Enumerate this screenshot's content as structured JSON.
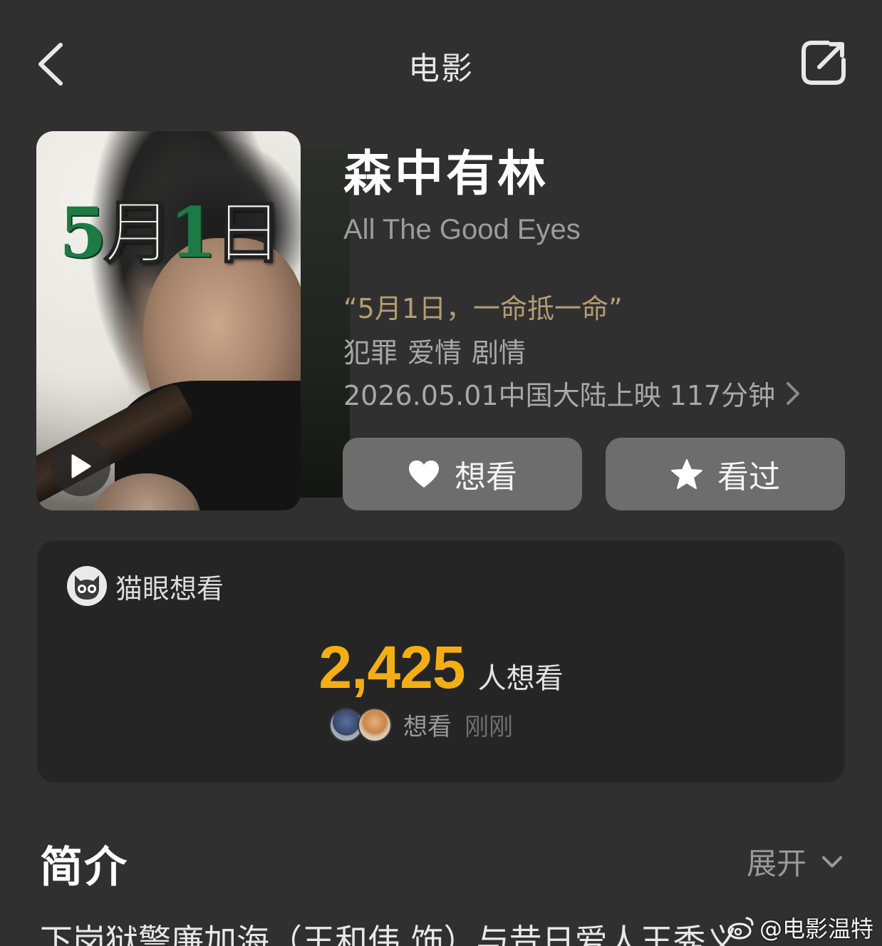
{
  "nav": {
    "title": "电影",
    "back_icon": "chevron-left-icon",
    "share_icon": "share-icon"
  },
  "poster": {
    "date_part1": "5",
    "date_part2": "月",
    "date_part3": "1",
    "date_part4": "日",
    "play_icon": "play-icon"
  },
  "movie": {
    "title": "森中有林",
    "english_title": "All The Good Eyes",
    "tagline": "“5月1日，一命抵一命”",
    "genres": [
      "犯罪",
      "爱情",
      "剧情"
    ],
    "release": "2026.05.01中国大陆上映 117分钟"
  },
  "actions": {
    "want_label": "想看",
    "seen_label": "看过"
  },
  "want_card": {
    "title": "猫眼想看",
    "count": "2,425",
    "count_unit": "人想看",
    "recent_label": "想看",
    "recent_time": "刚刚"
  },
  "synopsis": {
    "title": "简介",
    "expand_label": "展开",
    "text": "下岗狱警廉加海（王和伟 饰）与昔日爱人王秀义"
  },
  "watermark": {
    "text": "@电影温特"
  },
  "colors": {
    "background": "#303030",
    "card": "#252525",
    "accent_count": "#f4ae14",
    "tagline": "#b49d72",
    "button": "#6d6d6d"
  }
}
